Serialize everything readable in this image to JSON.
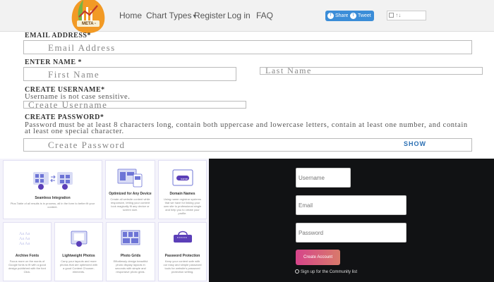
{
  "nav": {
    "logo_text": "META -",
    "items": [
      "Home",
      "Chart Types",
      "Register",
      "Log in",
      "FAQ"
    ],
    "share_label": "Share",
    "tweet_label": "Tweet",
    "vote_icons": "↑↓"
  },
  "form": {
    "email": {
      "label": "EMAIL ADDRESS*",
      "placeholder": "Email Address"
    },
    "name": {
      "label": "ENTER NAME *",
      "first_placeholder": "First Name",
      "last_placeholder": "Last Name"
    },
    "username": {
      "label": "CREATE USERNAME*",
      "note": "Username is not case sensitive.",
      "placeholder": "Create Username"
    },
    "password": {
      "label": "CREATE PASSWORD*",
      "note": "Password must be at least 8 characters long, contain both uppercase and lowercase letters, contain at least one number, and contain at least one special character.",
      "placeholder": "Create Password",
      "show_label": "SHOW"
    }
  },
  "features": {
    "cards": [
      {
        "title": "Seamless Integration",
        "desc": "Plus Table of all results is in process, all in the form to better fit your content."
      },
      {
        "title": "Optimized for Any Device",
        "desc": "Create all website content while responsive, letting your content look magically fit any device or screen size."
      },
      {
        "title": "Domain Names",
        "desc": "Using name registrar systems that we have for linking your own site to professional single and help you to create your profile."
      },
      {
        "title": "Archive Fonts",
        "desc": "Focus more on the words of Google fonts to fit with a good design published with the font Click."
      },
      {
        "title": "Lightweight Photos",
        "desc": "Carry your layouts and more photos that are optimized with a good Content Chooser-elements."
      },
      {
        "title": "Photo Grids",
        "desc": "Effortlessly design beautiful photo display layouts in seconds with simple and responsive photo grids."
      },
      {
        "title": "Password Protection",
        "desc": "Keep your content safe with our easy and simple password tools for website's password protection setting."
      }
    ],
    "password_badge": "*****",
    "domain_badge": "name"
  },
  "signup": {
    "username_placeholder": "Username",
    "email_placeholder": "Email",
    "password_placeholder": "Password",
    "create_label": "Create Account",
    "note": "Sign up for the Community list"
  }
}
